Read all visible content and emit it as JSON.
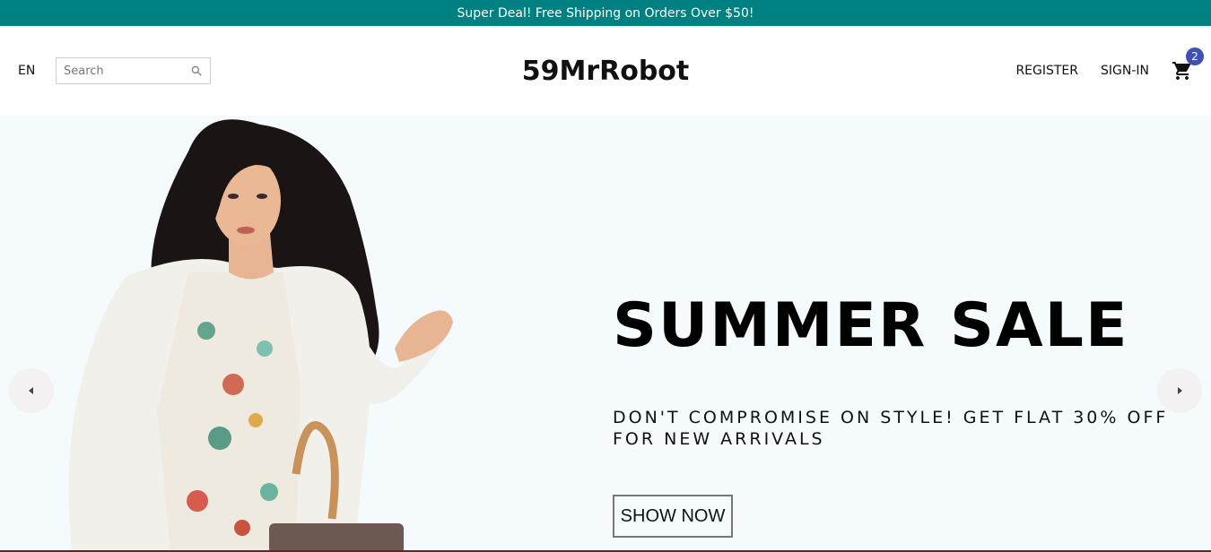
{
  "announcement": {
    "text": "Super Deal! Free Shipping on Orders Over $50!",
    "bg_color": "#008080"
  },
  "navbar": {
    "language": "EN",
    "search": {
      "placeholder": "Search",
      "value": "",
      "icon": "search-icon"
    },
    "logo": "59MrRobot",
    "links": {
      "register": "REGISTER",
      "sign_in": "SIGN-IN"
    },
    "cart": {
      "icon": "shopping-cart-icon",
      "badge_count": "2",
      "badge_color": "#3f51b5"
    }
  },
  "slider": {
    "bg_color": "#f5fafd",
    "prev_icon": "arrow-left-icon",
    "next_icon": "arrow-right-icon",
    "slide": {
      "title": "SUMMER SALE",
      "description": "DON'T COMPROMISE ON STYLE! GET FLAT 30% OFF FOR NEW ARRIVALS",
      "button": "SHOW NOW"
    }
  }
}
